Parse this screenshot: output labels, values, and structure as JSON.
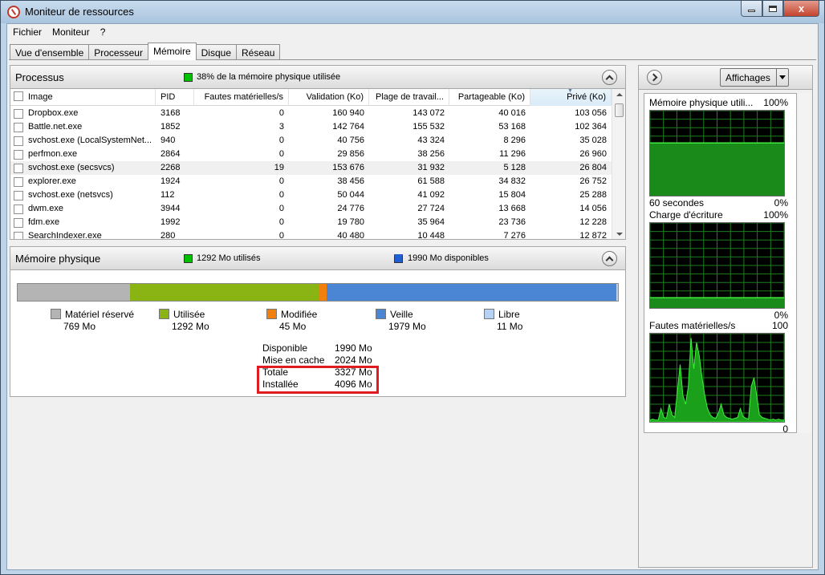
{
  "window": {
    "title": "Moniteur de ressources",
    "close_glyph": "x"
  },
  "menu": [
    "Fichier",
    "Moniteur",
    "?"
  ],
  "tabs": [
    {
      "label": "Vue d'ensemble",
      "active": false
    },
    {
      "label": "Processeur",
      "active": false
    },
    {
      "label": "Mémoire",
      "active": true
    },
    {
      "label": "Disque",
      "active": false
    },
    {
      "label": "Réseau",
      "active": false
    }
  ],
  "processes": {
    "title": "Processus",
    "summary": "38% de la mémoire physique utilisée",
    "columns": [
      "Image",
      "PID",
      "Fautes matérielles/s",
      "Validation (Ko)",
      "Plage de travail...",
      "Partageable (Ko)",
      "Privé (Ko)"
    ],
    "rows": [
      [
        "Dropbox.exe",
        "3168",
        "0",
        "160 940",
        "143 072",
        "40 016",
        "103 056"
      ],
      [
        "Battle.net.exe",
        "1852",
        "3",
        "142 764",
        "155 532",
        "53 168",
        "102 364"
      ],
      [
        "svchost.exe (LocalSystemNet...",
        "940",
        "0",
        "40 756",
        "43 324",
        "8 296",
        "35 028"
      ],
      [
        "perfmon.exe",
        "2864",
        "0",
        "29 856",
        "38 256",
        "11 296",
        "26 960"
      ],
      [
        "svchost.exe (secsvcs)",
        "2268",
        "19",
        "153 676",
        "31 932",
        "5 128",
        "26 804"
      ],
      [
        "explorer.exe",
        "1924",
        "0",
        "38 456",
        "61 588",
        "34 832",
        "26 752"
      ],
      [
        "svchost.exe (netsvcs)",
        "112",
        "0",
        "50 044",
        "41 092",
        "15 804",
        "25 288"
      ],
      [
        "dwm.exe",
        "3944",
        "0",
        "24 776",
        "27 724",
        "13 668",
        "14 056"
      ],
      [
        "fdm.exe",
        "1992",
        "0",
        "19 780",
        "35 964",
        "23 736",
        "12 228"
      ],
      [
        "SearchIndexer.exe",
        "280",
        "0",
        "40 480",
        "10 448",
        "7 276",
        "12 872"
      ]
    ]
  },
  "physical_memory": {
    "title": "Mémoire physique",
    "used_label": "1292 Mo utilisés",
    "available_label": "1990 Mo disponibles",
    "legend": [
      {
        "label": "Matériel réservé",
        "value": "769 Mo",
        "color": "#b4b4b4"
      },
      {
        "label": "Utilisée",
        "value": "1292 Mo",
        "color": "#8ab413"
      },
      {
        "label": "Modifiée",
        "value": "45 Mo",
        "color": "#f07f0b"
      },
      {
        "label": "Veille",
        "value": "1979 Mo",
        "color": "#4a86d4"
      },
      {
        "label": "Libre",
        "value": "11 Mo",
        "color": "#b6d1f1"
      }
    ],
    "stats": [
      {
        "label": "Disponible",
        "value": "1990 Mo"
      },
      {
        "label": "Mise en cache",
        "value": "2024 Mo"
      },
      {
        "label": "Totale",
        "value": "3327 Mo"
      },
      {
        "label": "Installée",
        "value": "4096 Mo"
      }
    ]
  },
  "right_panel": {
    "views_label": "Affichages",
    "graphs": [
      {
        "title": "Mémoire physique utili...",
        "max": "100%",
        "min": "0%",
        "left_footer": "60 secondes",
        "level": 0.62
      },
      {
        "title": "Charge d'écriture",
        "max": "100%",
        "min": "0%",
        "left_footer": "",
        "level": 0.12
      },
      {
        "title": "Fautes matérielles/s",
        "max": "100",
        "min": "0",
        "left_footer": "",
        "level": 0.0
      }
    ]
  }
}
